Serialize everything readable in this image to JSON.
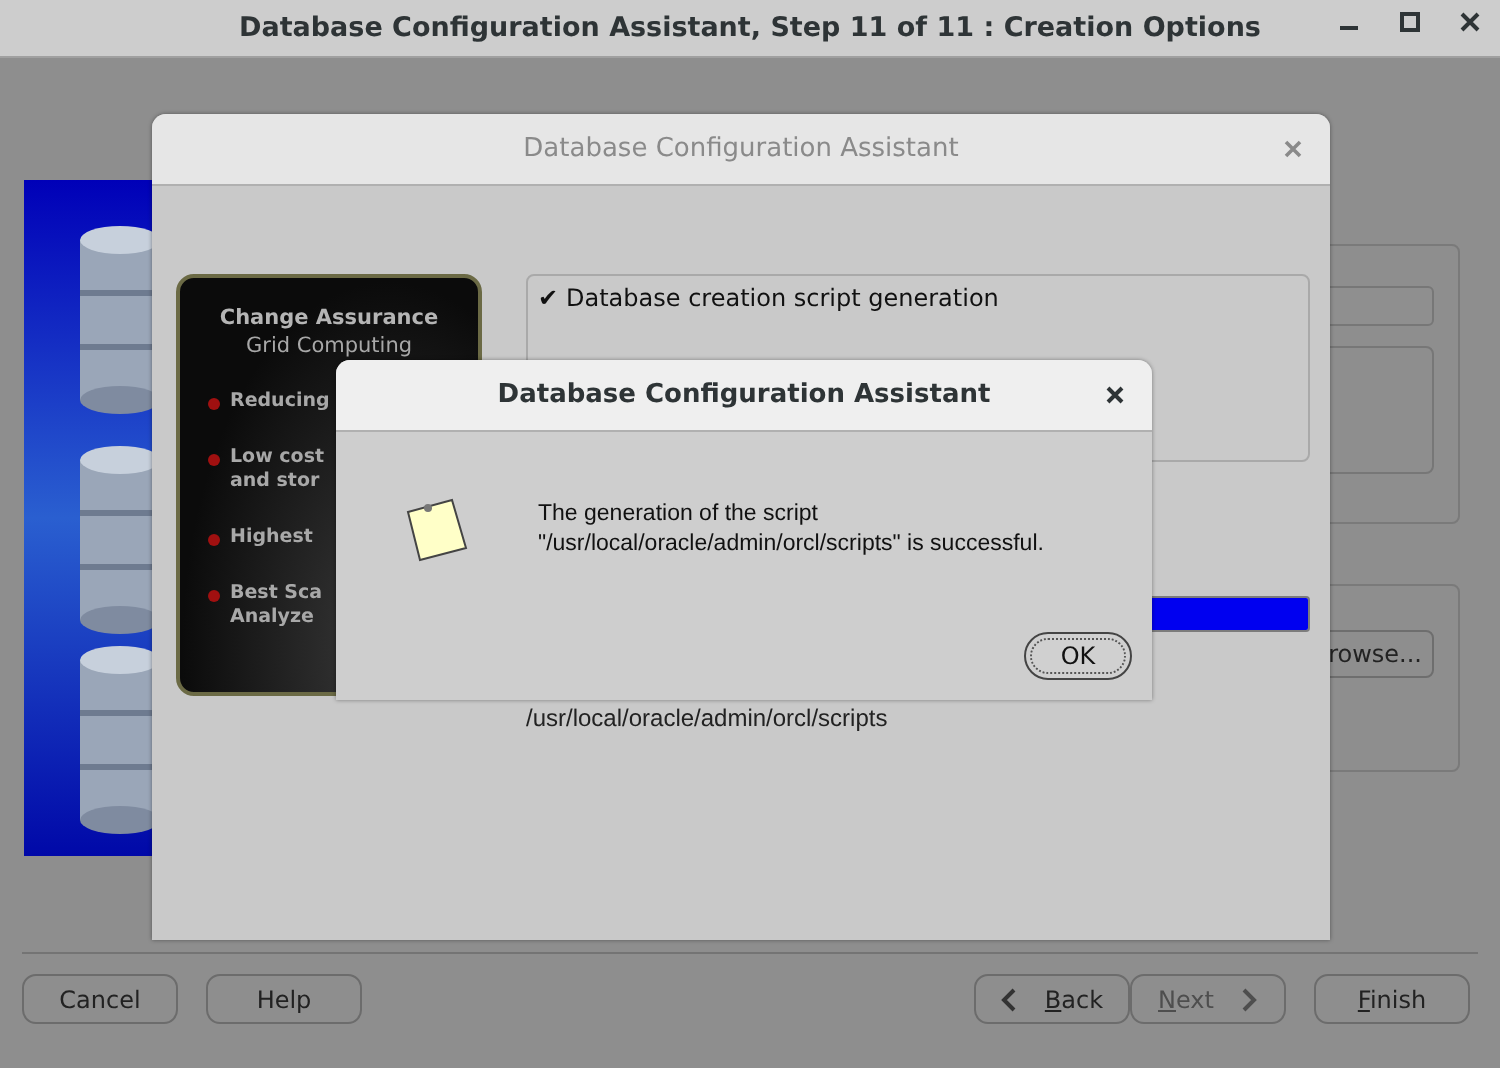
{
  "window": {
    "title": "Database Configuration Assistant, Step 11 of 11 : Creation Options",
    "browse_button": "rowse...",
    "buttons": [
      {
        "label": "Cancel",
        "kind": "plain",
        "mnemonic": false,
        "disabled": false
      },
      {
        "label": "Help",
        "kind": "plain",
        "mnemonic": false,
        "disabled": false
      },
      {
        "label": "Back",
        "kind": "back",
        "mnemonic": true,
        "disabled": false
      },
      {
        "label": "Next",
        "kind": "next",
        "mnemonic": true,
        "disabled": true
      },
      {
        "label": "Finish",
        "kind": "plain",
        "mnemonic": true,
        "disabled": false
      }
    ]
  },
  "progress_dialog": {
    "title": "Database Configuration Assistant",
    "promo": {
      "heading": "Change Assurance",
      "subheading": "Grid Computing",
      "bullets": [
        {
          "lines": [
            "Reducing"
          ]
        },
        {
          "lines": [
            "Low cost",
            "and stor"
          ]
        },
        {
          "lines": [
            "Highest"
          ]
        },
        {
          "lines": [
            "Best Sca",
            "Analyze"
          ]
        }
      ]
    },
    "options": [
      {
        "mark": "✔",
        "label": "Database creation script generation",
        "checked": true
      }
    ],
    "progress": {
      "level": 1
    },
    "path": "/usr/local/oracle/admin/orcl/scripts"
  },
  "message_dialog": {
    "title": "Database Configuration Assistant",
    "message_lines": [
      "The generation of the script",
      "\"/usr/local/oracle/admin/orcl/scripts\" is successful."
    ],
    "ok_button": "OK"
  }
}
